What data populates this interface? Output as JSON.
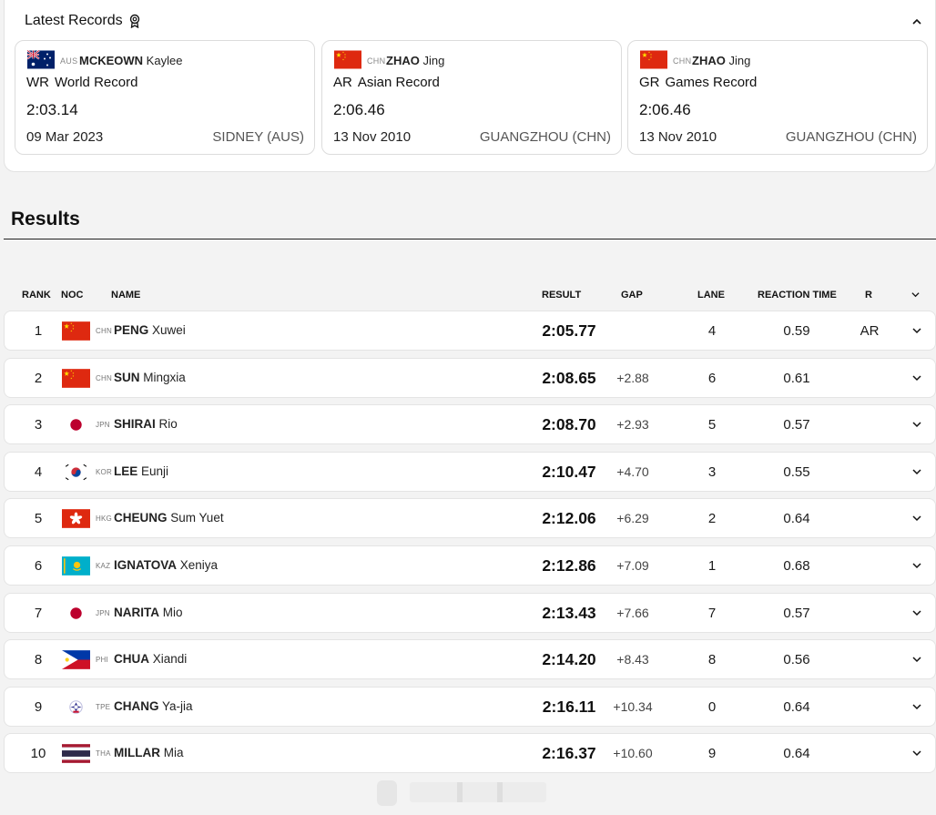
{
  "records": {
    "title": "Latest Records",
    "cards": [
      {
        "noc": "AUS",
        "surname": "MCKEOWN",
        "given": "Kaylee",
        "code": "WR",
        "label": "World Record",
        "time": "2:03.14",
        "date": "09 Mar 2023",
        "place": "SIDNEY (AUS)",
        "flag": "aus"
      },
      {
        "noc": "CHN",
        "surname": "ZHAO",
        "given": "Jing",
        "code": "AR",
        "label": "Asian Record",
        "time": "2:06.46",
        "date": "13 Nov 2010",
        "place": "GUANGZHOU (CHN)",
        "flag": "chn"
      },
      {
        "noc": "CHN",
        "surname": "ZHAO",
        "given": "Jing",
        "code": "GR",
        "label": "Games Record",
        "time": "2:06.46",
        "date": "13 Nov 2010",
        "place": "GUANGZHOU (CHN)",
        "flag": "chn"
      }
    ]
  },
  "results": {
    "title": "Results",
    "headers": {
      "rank": "RANK",
      "noc": "NOC",
      "name": "NAME",
      "result": "RESULT",
      "gap": "GAP",
      "lane": "LANE",
      "reaction": "REACTION TIME",
      "record": "R"
    },
    "rows": [
      {
        "rank": "1",
        "flag": "chn",
        "noc": "CHN",
        "surname": "PENG",
        "given": "Xuwei",
        "result": "2:05.77",
        "gap": "",
        "lane": "4",
        "reaction": "0.59",
        "record": "AR"
      },
      {
        "rank": "2",
        "flag": "chn",
        "noc": "CHN",
        "surname": "SUN",
        "given": "Mingxia",
        "result": "2:08.65",
        "gap": "+2.88",
        "lane": "6",
        "reaction": "0.61",
        "record": ""
      },
      {
        "rank": "3",
        "flag": "jpn",
        "noc": "JPN",
        "surname": "SHIRAI",
        "given": "Rio",
        "result": "2:08.70",
        "gap": "+2.93",
        "lane": "5",
        "reaction": "0.57",
        "record": ""
      },
      {
        "rank": "4",
        "flag": "kor",
        "noc": "KOR",
        "surname": "LEE",
        "given": "Eunji",
        "result": "2:10.47",
        "gap": "+4.70",
        "lane": "3",
        "reaction": "0.55",
        "record": ""
      },
      {
        "rank": "5",
        "flag": "hkg",
        "noc": "HKG",
        "surname": "CHEUNG",
        "given": "Sum Yuet",
        "result": "2:12.06",
        "gap": "+6.29",
        "lane": "2",
        "reaction": "0.64",
        "record": ""
      },
      {
        "rank": "6",
        "flag": "kaz",
        "noc": "KAZ",
        "surname": "IGNATOVA",
        "given": "Xeniya",
        "result": "2:12.86",
        "gap": "+7.09",
        "lane": "1",
        "reaction": "0.68",
        "record": ""
      },
      {
        "rank": "7",
        "flag": "jpn",
        "noc": "JPN",
        "surname": "NARITA",
        "given": "Mio",
        "result": "2:13.43",
        "gap": "+7.66",
        "lane": "7",
        "reaction": "0.57",
        "record": ""
      },
      {
        "rank": "8",
        "flag": "phi",
        "noc": "PHI",
        "surname": "CHUA",
        "given": "Xiandi",
        "result": "2:14.20",
        "gap": "+8.43",
        "lane": "8",
        "reaction": "0.56",
        "record": ""
      },
      {
        "rank": "9",
        "flag": "tpe",
        "noc": "TPE",
        "surname": "CHANG",
        "given": "Ya-jia",
        "result": "2:16.11",
        "gap": "+10.34",
        "lane": "0",
        "reaction": "0.64",
        "record": ""
      },
      {
        "rank": "10",
        "flag": "tha",
        "noc": "THA",
        "surname": "MILLAR",
        "given": "Mia",
        "result": "2:16.37",
        "gap": "+10.60",
        "lane": "9",
        "reaction": "0.64",
        "record": ""
      }
    ]
  }
}
